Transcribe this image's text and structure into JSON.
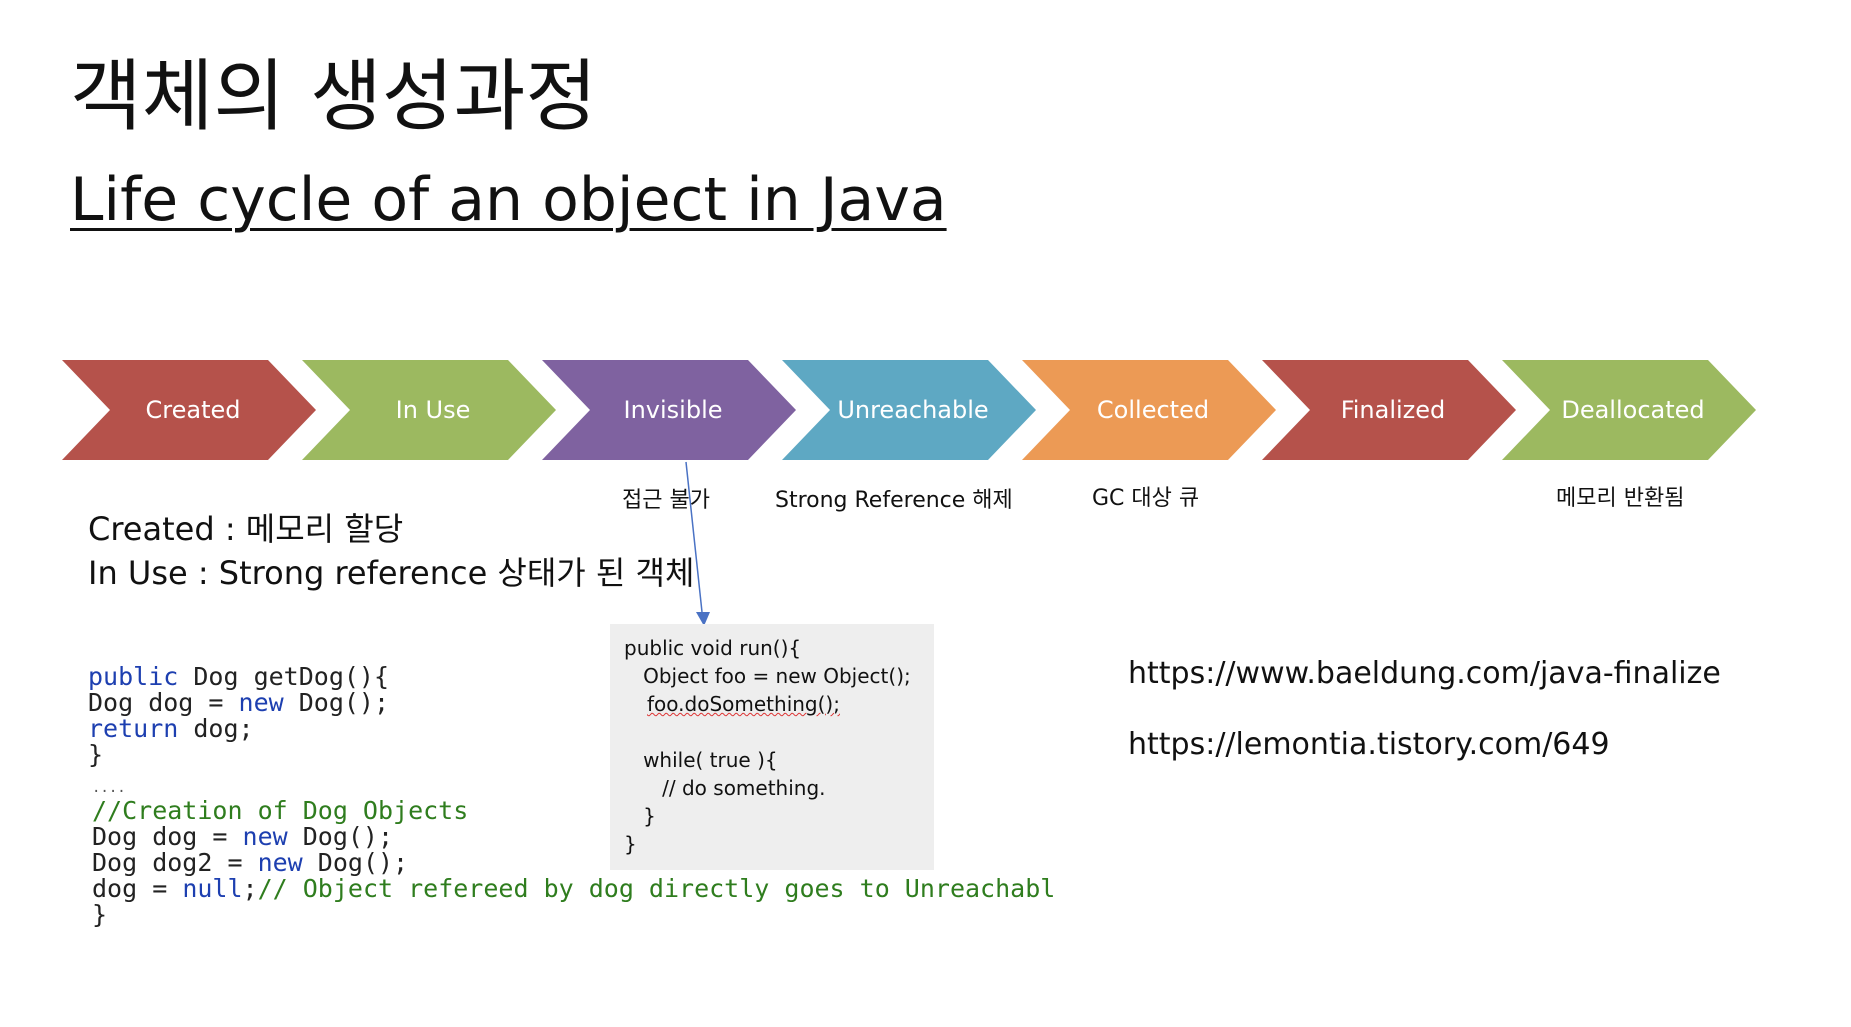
{
  "title": "객체의 생성과정",
  "subtitle": "Life cycle of an object in Java",
  "stages": [
    {
      "label": "Created",
      "color": "#b5524b"
    },
    {
      "label": "In Use",
      "color": "#9cb960"
    },
    {
      "label": "Invisible",
      "color": "#7f62a0"
    },
    {
      "label": "Unreachable",
      "color": "#5ea8c3"
    },
    {
      "label": "Collected",
      "color": "#ec9a55"
    },
    {
      "label": "Finalized",
      "color": "#b5524b"
    },
    {
      "label": "Deallocated",
      "color": "#9cb960"
    }
  ],
  "notes": {
    "invisible": "접근 불가",
    "unreachable": "Strong Reference 해제",
    "collected": "GC 대상 큐",
    "deallocated": "메모리 반환됨"
  },
  "descriptions": {
    "created": "Created : 메모리 할당",
    "in_use": "In Use : Strong reference 상태가 된 객체"
  },
  "code_left": {
    "l1_kw": "public",
    "l1_rest": " Dog getDog(){",
    "l2_a": "Dog dog = ",
    "l2_kw": "new",
    "l2_b": " Dog();",
    "l3_kw": "return",
    "l3_rest": " dog;",
    "l4": "}",
    "l5": "....",
    "l6": "//Creation of Dog Objects",
    "l7_a": "Dog dog = ",
    "l7_kw": "new",
    "l7_b": " Dog();",
    "l8_a": "Dog dog2 = ",
    "l8_kw": "new",
    "l8_b": " Dog();",
    "l9_a": "dog = ",
    "l9_kw": "null",
    "l9_b": ";",
    "l9_cm": "// Object refereed by dog directly goes to Unreachabl",
    "l10": "}"
  },
  "code_box": {
    "l1": "public void run(){",
    "l2": "   Object foo = new Object();",
    "l3": "foo.doSomething();",
    "l4": "   while( true ){",
    "l5": "      // do something.",
    "l6": "   }",
    "l7": "}"
  },
  "links": [
    "https://www.baeldung.com/java-finalize",
    "https://lemontia.tistory.com/649"
  ],
  "arrow_color": "#4a72c4"
}
